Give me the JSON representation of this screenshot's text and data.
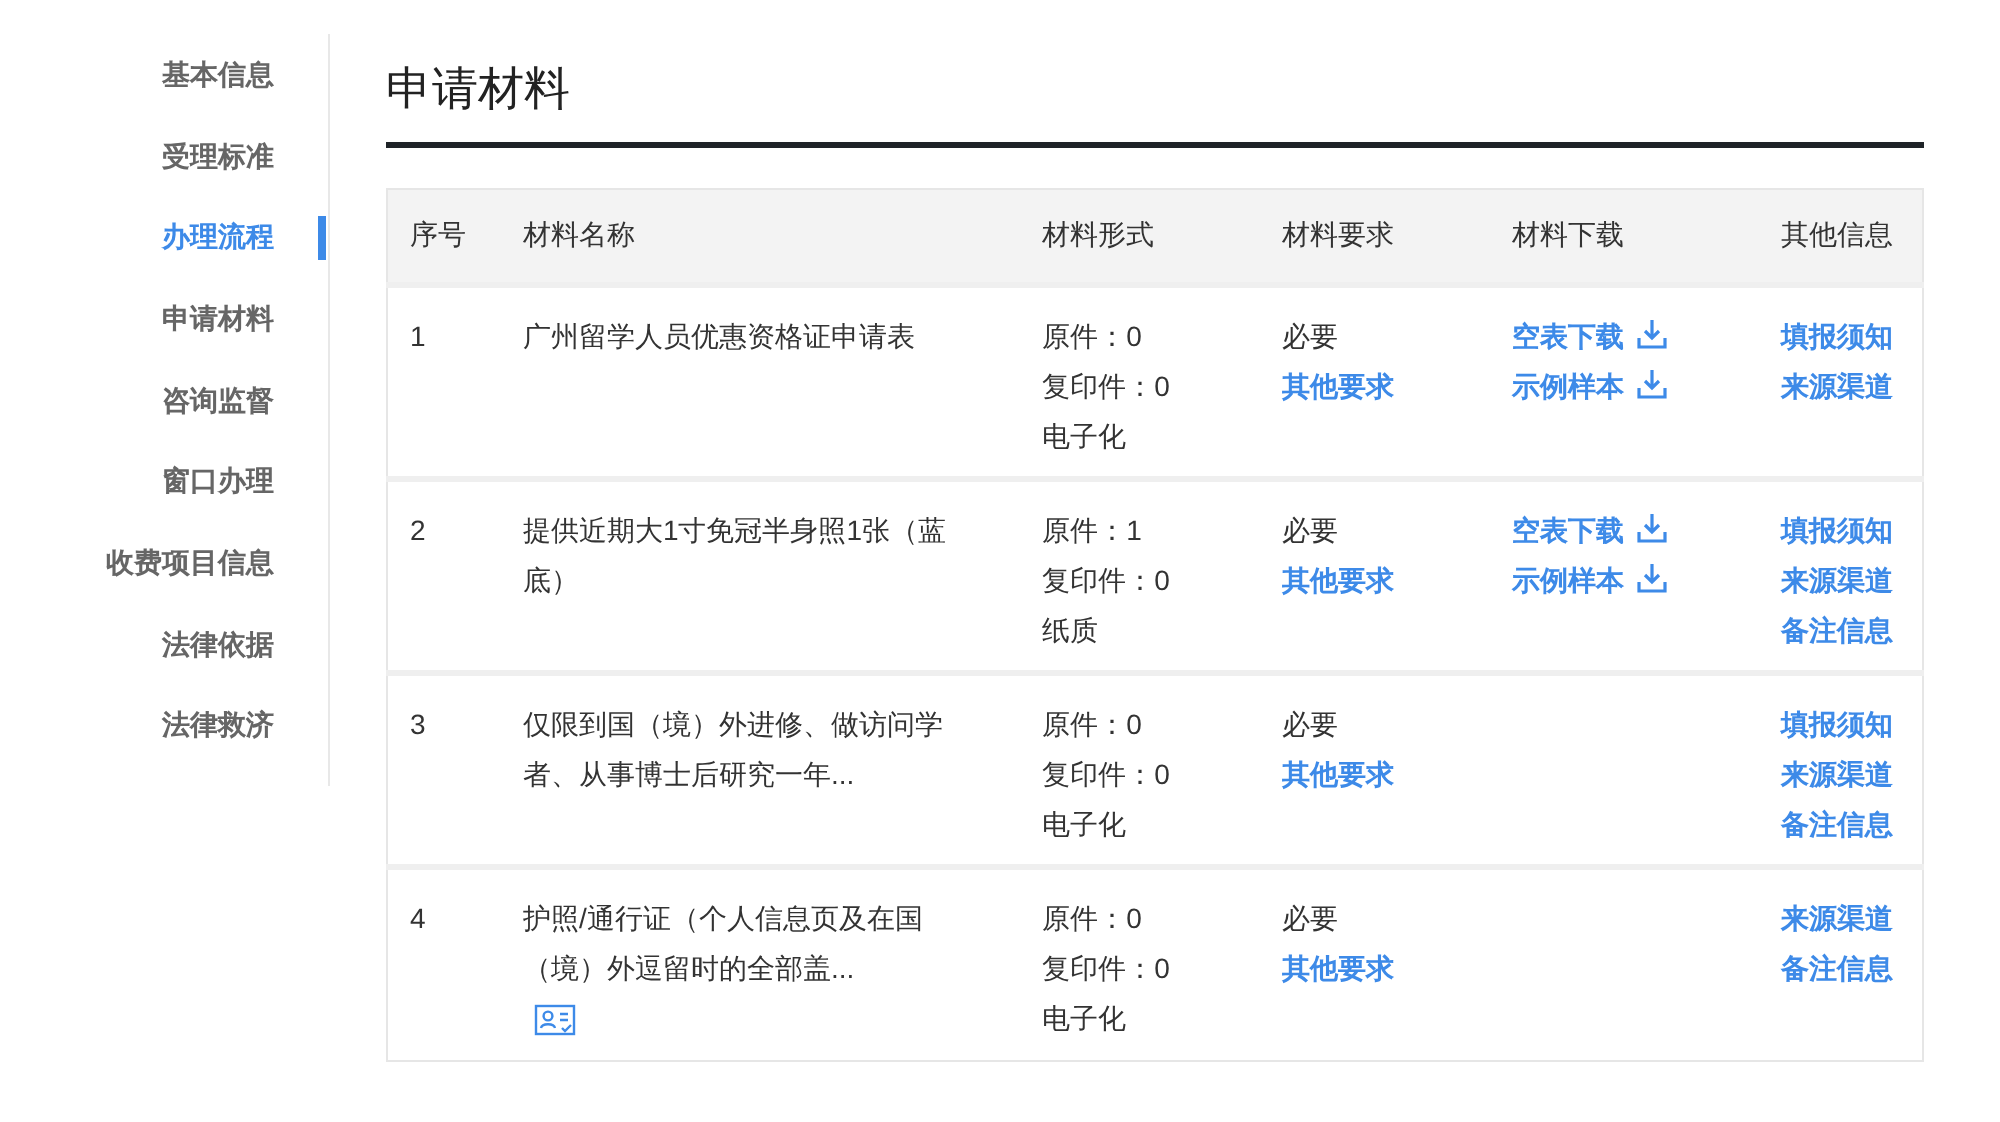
{
  "sidebar": {
    "items": [
      {
        "label": "基本信息",
        "selected": false
      },
      {
        "label": "受理标准",
        "selected": false
      },
      {
        "label": "办理流程",
        "selected": true
      },
      {
        "label": "申请材料",
        "selected": false
      },
      {
        "label": "咨询监督",
        "selected": false
      },
      {
        "label": "窗口办理",
        "selected": false
      },
      {
        "label": "收费项目信息",
        "selected": false
      },
      {
        "label": "法律依据",
        "selected": false
      },
      {
        "label": "法律救济",
        "selected": false
      }
    ]
  },
  "title": "申请材料",
  "table": {
    "columns": [
      "序号",
      "材料名称",
      "材料形式",
      "材料要求",
      "材料下载",
      "其他信息"
    ],
    "rows": [
      {
        "no": "1",
        "name": "广州留学人员优惠资格证申请表",
        "form": [
          "原件：0",
          "复印件：0",
          "电子化"
        ],
        "requirement": "必要",
        "requirement_link": "其他要求",
        "downloads": [
          "空表下载",
          "示例样本"
        ],
        "other": [
          "填报须知",
          "来源渠道"
        ]
      },
      {
        "no": "2",
        "name": "提供近期大1寸免冠半身照1张（蓝底）",
        "form": [
          "原件：1",
          "复印件：0",
          "纸质"
        ],
        "requirement": "必要",
        "requirement_link": "其他要求",
        "downloads": [
          "空表下载",
          "示例样本"
        ],
        "other": [
          "填报须知",
          "来源渠道",
          "备注信息"
        ]
      },
      {
        "no": "3",
        "name": "仅限到国（境）外进修、做访问学者、从事博士后研究一年...",
        "form": [
          "原件：0",
          "复印件：0",
          "电子化"
        ],
        "requirement": "必要",
        "requirement_link": "其他要求",
        "other": [
          "填报须知",
          "来源渠道",
          "备注信息"
        ]
      },
      {
        "no": "4",
        "name": "护照/通行证（个人信息页及在国（境）外逗留时的全部盖...",
        "id_card_icon": true,
        "form": [
          "原件：0",
          "复印件：0",
          "电子化"
        ],
        "requirement": "必要",
        "requirement_link": "其他要求",
        "other": [
          "来源渠道",
          "备注信息"
        ]
      }
    ]
  }
}
